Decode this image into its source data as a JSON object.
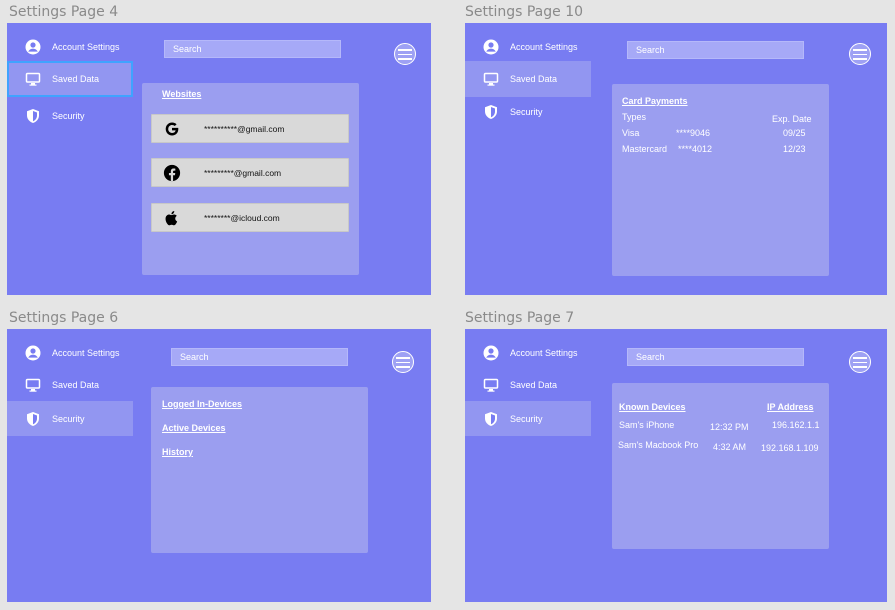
{
  "colors": {
    "frame_bg": "#787cf2",
    "panel_bg": "#9b9ef0",
    "active_nav_bg": "#9296f1",
    "focus_outline": "#3fa3ff",
    "canvas_bg": "#e5e5e5"
  },
  "nav": {
    "account": "Account Settings",
    "saved": "Saved Data",
    "security": "Security"
  },
  "nav_icons": {
    "account": "user-circle-icon",
    "saved": "monitor-icon",
    "security": "shield-icon"
  },
  "search_placeholder": "Search",
  "frames": {
    "page4": {
      "title": "Settings Page 4",
      "active_nav": "saved",
      "panel_heading": "Websites",
      "rows": [
        {
          "icon": "google-icon",
          "email": "**********@gmail.com"
        },
        {
          "icon": "facebook-icon",
          "email": "*********@gmail.com"
        },
        {
          "icon": "apple-icon",
          "email": "********@icloud.com"
        }
      ]
    },
    "page10": {
      "title": "Settings Page 10",
      "active_nav": "saved",
      "panel_heading": "Card Payments",
      "col_types": "Types",
      "col_exp": "Exp. Date",
      "cards": [
        {
          "type": "Visa",
          "number": "****9046",
          "exp": "09/25"
        },
        {
          "type": "Mastercard",
          "number": "****4012",
          "exp": "12/23"
        }
      ]
    },
    "page6": {
      "title": "Settings Page 6",
      "active_nav": "security",
      "links": [
        "Logged In-Devices",
        "Active Devices",
        "History"
      ]
    },
    "page7": {
      "title": "Settings Page 7",
      "active_nav": "security",
      "col_devices": "Known Devices",
      "col_ip": "IP Address",
      "devices": [
        {
          "name": "Sam's iPhone",
          "time": "12:32 PM",
          "ip": "196.162.1.1"
        },
        {
          "name": "Sam's Macbook Pro",
          "time": "4:32 AM",
          "ip": "192.168.1.109"
        }
      ]
    }
  }
}
